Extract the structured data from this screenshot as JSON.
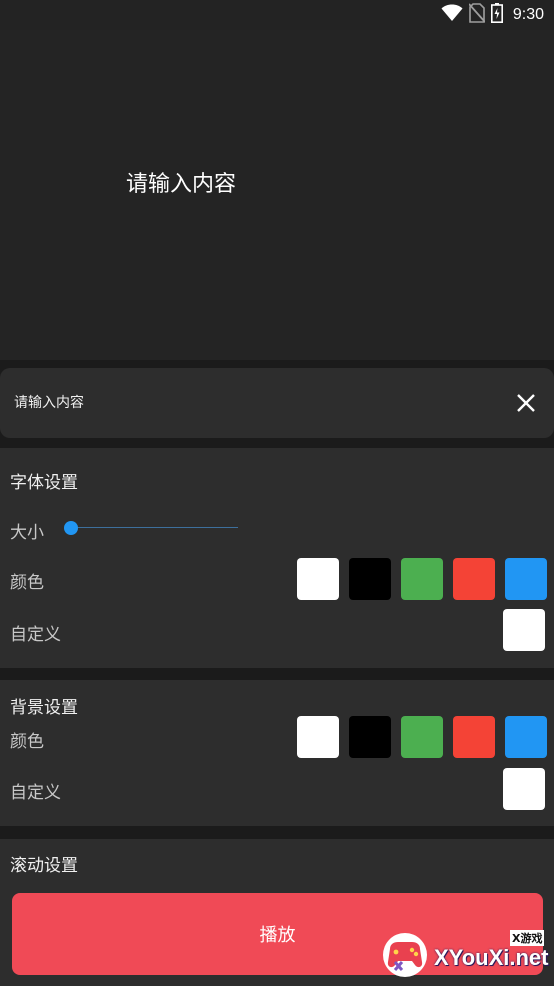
{
  "status_bar": {
    "time": "9:30",
    "icons": [
      "wifi-icon",
      "no-sim-icon",
      "battery-icon"
    ]
  },
  "preview": {
    "text": "请输入内容"
  },
  "input": {
    "value": "请输入内容",
    "clear_icon": "close-icon"
  },
  "font_settings": {
    "title": "字体设置",
    "size_label": "大小",
    "size_value": 0,
    "color_label": "颜色",
    "custom_label": "自定义",
    "colors": [
      "#ffffff",
      "#000000",
      "#4caf50",
      "#f44336",
      "#2196f3"
    ],
    "custom_color": "#ffffff"
  },
  "bg_settings": {
    "title": "背景设置",
    "color_label": "颜色",
    "custom_label": "自定义",
    "colors": [
      "#ffffff",
      "#000000",
      "#4caf50",
      "#f44336",
      "#2196f3"
    ],
    "custom_color": "#ffffff"
  },
  "scroll_settings": {
    "title": "滚动设置"
  },
  "play_button": {
    "label": "播放",
    "color": "#f04a56"
  },
  "watermark": {
    "top_text": "X游戏",
    "main_text": "XYouXi.net"
  }
}
